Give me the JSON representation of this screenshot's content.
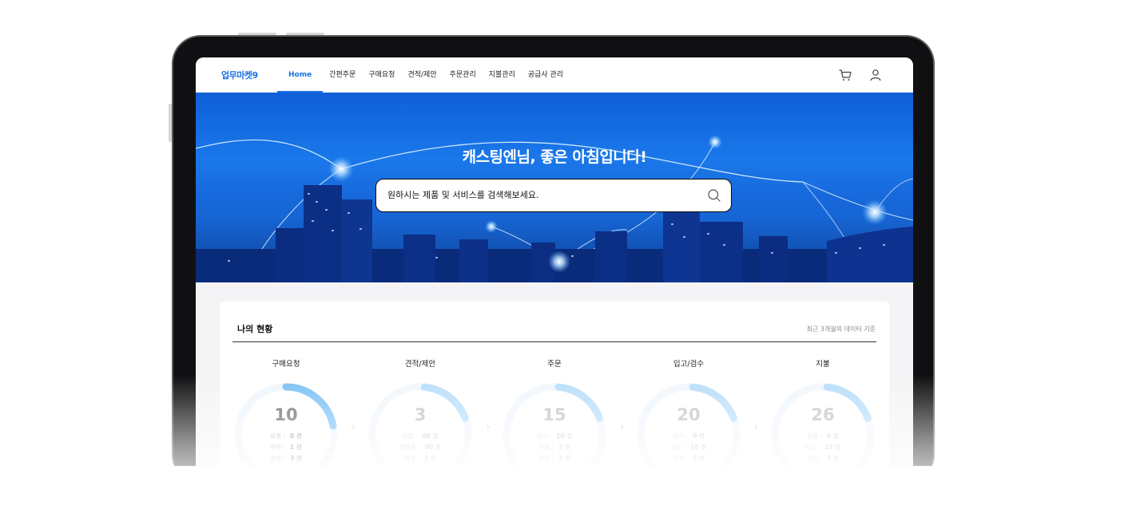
{
  "brand": {
    "logo": "업무마켓9",
    "accent": "#1a73e8"
  },
  "nav": {
    "items": [
      {
        "label": "Home",
        "active": true
      },
      {
        "label": "간편주문"
      },
      {
        "label": "구매요청"
      },
      {
        "label": "견적/제안"
      },
      {
        "label": "주문관리"
      },
      {
        "label": "지불관리"
      },
      {
        "label": "공급사 관리"
      }
    ],
    "icons": [
      "cart-icon",
      "user-icon"
    ]
  },
  "hero": {
    "greeting": "캐스팅엔님, 좋은 아침입니다!",
    "search_placeholder": "원하시는 제품 및 서비스를 검색해보세요."
  },
  "status": {
    "title": "나의 현황",
    "note": "최근 3개월의 데이터 기준",
    "cards": [
      {
        "label": "구매요청",
        "total": "10",
        "progress": 0.22,
        "rows": [
          {
            "k": "요청 :",
            "v": "0 건"
          },
          {
            "k": "반려 :",
            "v": "1 건"
          },
          {
            "k": "승인 :",
            "v": "3 건"
          }
        ]
      },
      {
        "label": "견적/제안",
        "total": "3",
        "progress": 0.18,
        "rows": [
          {
            "k": "모집 :",
            "v": "00 건"
          },
          {
            "k": "선정중 :",
            "v": "00 건"
          },
          {
            "k": "완료 :",
            "v": "3 건"
          }
        ]
      },
      {
        "label": "주문",
        "total": "15",
        "progress": 0.18,
        "rows": [
          {
            "k": "대기 :",
            "v": "10 건"
          },
          {
            "k": "완료 :",
            "v": "3 건"
          },
          {
            "k": "반려 :",
            "v": "2 건"
          }
        ]
      },
      {
        "label": "입고/검수",
        "total": "20",
        "progress": 0.18,
        "rows": [
          {
            "k": "대기 :",
            "v": "0 건"
          },
          {
            "k": "승인 :",
            "v": "16 건"
          },
          {
            "k": "반려 :",
            "v": "0 건"
          }
        ]
      },
      {
        "label": "지불",
        "total": "26",
        "progress": 0.18,
        "rows": [
          {
            "k": "요청 :",
            "v": "6 건"
          },
          {
            "k": "승인 :",
            "v": "13 건"
          },
          {
            "k": "반려 :",
            "v": "7 건"
          }
        ]
      }
    ]
  }
}
